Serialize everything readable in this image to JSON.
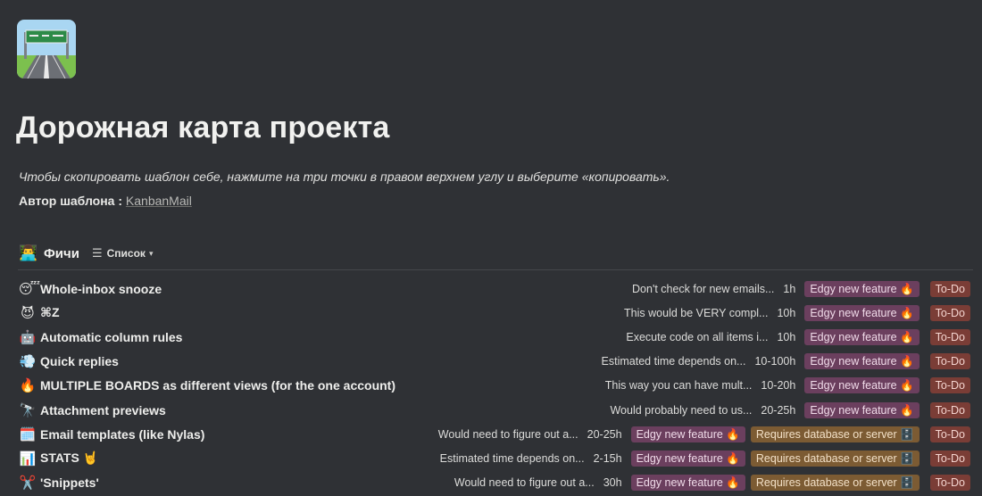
{
  "page": {
    "title": "Дорожная карта проекта",
    "description": "Чтобы скопировать шаблон себе, нажмите на три точки в правом верхнем углу и выберите «копировать».",
    "author_label": "Автор шаблона :",
    "author_link": "KanbanMail"
  },
  "database": {
    "emoji": "👨‍💻",
    "title": "Фичи",
    "view_label": "Список"
  },
  "rows": [
    {
      "emoji": "😴",
      "title": "Whole-inbox snooze",
      "description": "Don't check for new emails...",
      "estimate": "1h",
      "tags": [
        "Edgy new feature 🔥"
      ],
      "status": "To-Do"
    },
    {
      "emoji": "😈",
      "title": "⌘Z",
      "description": "This would be VERY compl...",
      "estimate": "10h",
      "tags": [
        "Edgy new feature 🔥"
      ],
      "status": "To-Do"
    },
    {
      "emoji": "🤖",
      "title": "Automatic column rules",
      "description": "Execute code on all items i...",
      "estimate": "10h",
      "tags": [
        "Edgy new feature 🔥"
      ],
      "status": "To-Do"
    },
    {
      "emoji": "💨",
      "title": "Quick replies",
      "description": "Estimated time depends on...",
      "estimate": "10-100h",
      "tags": [
        "Edgy new feature 🔥"
      ],
      "status": "To-Do"
    },
    {
      "emoji": "🔥",
      "title": "MULTIPLE BOARDS as different views (for the one account)",
      "description": "This way you can have mult...",
      "estimate": "10-20h",
      "tags": [
        "Edgy new feature 🔥"
      ],
      "status": "To-Do"
    },
    {
      "emoji": "🔭",
      "title": "Attachment previews",
      "description": "Would probably need to us...",
      "estimate": "20-25h",
      "tags": [
        "Edgy new feature 🔥"
      ],
      "status": "To-Do"
    },
    {
      "emoji": "🗓️",
      "title": "Email templates (like Nylas)",
      "description": "Would need to figure out a...",
      "estimate": "20-25h",
      "tags": [
        "Edgy new feature 🔥",
        "Requires database or server 🗄️"
      ],
      "status": "To-Do"
    },
    {
      "emoji": "📊",
      "title": "STATS 🤘",
      "description": "Estimated time depends on...",
      "estimate": "2-15h",
      "tags": [
        "Edgy new feature 🔥",
        "Requires database or server 🗄️"
      ],
      "status": "To-Do"
    },
    {
      "emoji": "✂️",
      "title": "'Snippets'",
      "description": "Would need to figure out a...",
      "estimate": "30h",
      "tags": [
        "Edgy new feature 🔥",
        "Requires database or server 🗄️"
      ],
      "status": "To-Do"
    }
  ],
  "colors": {
    "background": "#2f3135",
    "tag_edgy": "#6b3f5e",
    "tag_requires": "#7c5b33",
    "tag_todo": "#7a3d36"
  },
  "icons": {
    "page_icon": "road-sign-icon",
    "view_icon": "list-view-icon"
  }
}
